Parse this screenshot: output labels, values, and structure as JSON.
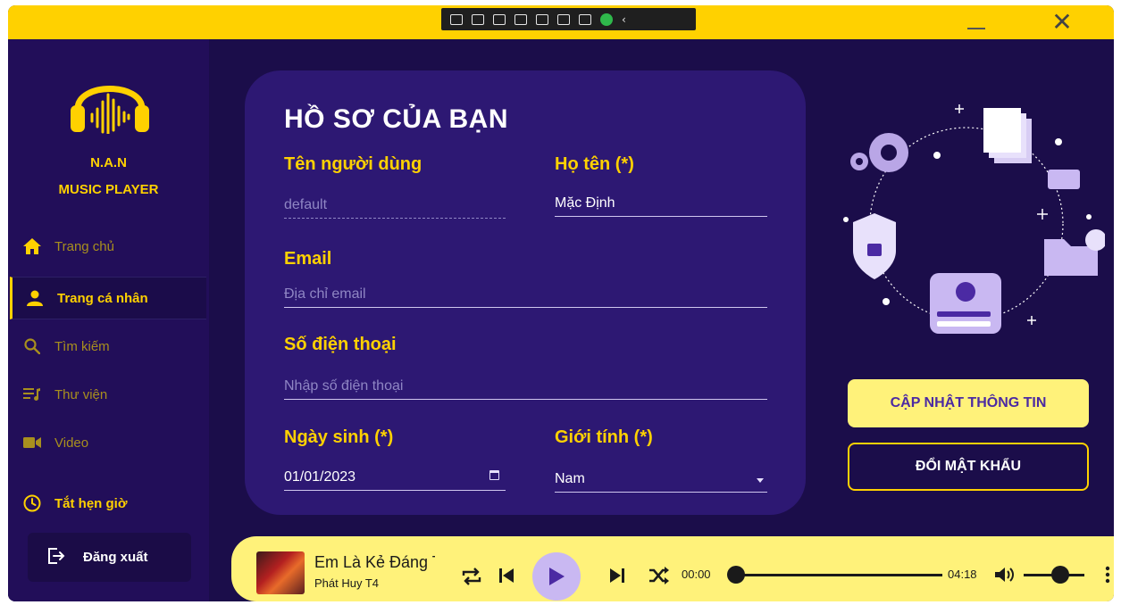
{
  "titlebar": {
    "minimize_label": "—",
    "close_label": "✕"
  },
  "sidebar": {
    "app_name_line1": "N.A.N",
    "app_name_line2": "MUSIC PLAYER",
    "items": [
      {
        "label": "Trang chủ",
        "icon": "home-icon"
      },
      {
        "label": "Trang cá nhân",
        "icon": "user-icon",
        "active": true
      },
      {
        "label": "Tìm kiếm",
        "icon": "search-icon"
      },
      {
        "label": "Thư viện",
        "icon": "library-icon"
      },
      {
        "label": "Video",
        "icon": "video-icon"
      },
      {
        "label": "Tắt hẹn giờ",
        "icon": "clock-icon"
      }
    ],
    "logout_label": "Đăng xuất"
  },
  "profile": {
    "title": "HỒ SƠ CỦA BẠN",
    "username_label": "Tên người dùng",
    "username_value": "default",
    "fullname_label": "Họ tên (*)",
    "fullname_value": "Mặc Định",
    "email_label": "Email",
    "email_placeholder": "Địa chỉ email",
    "phone_label": "Số điện thoại",
    "phone_placeholder": "Nhập số điện thoại",
    "dob_label": "Ngày sinh (*)",
    "dob_value": "01/01/2023",
    "gender_label": "Giới tính (*)",
    "gender_value": "Nam"
  },
  "actions": {
    "update_label": "CẬP NHẬT THÔNG TIN",
    "change_password_label": "ĐỔI MẬT KHẨU"
  },
  "player": {
    "song_title": "Em Là Kẻ Đáng Thương",
    "artist": "Phát Huy T4",
    "time_current": "00:00",
    "time_total": "04:18",
    "progress_fraction": 0,
    "volume_fraction": 0.6
  },
  "colors": {
    "accent": "#ffd100",
    "background": "#1b0d4a",
    "sidebar": "#220e59",
    "card": "#2d1873",
    "player": "#fff27a"
  }
}
